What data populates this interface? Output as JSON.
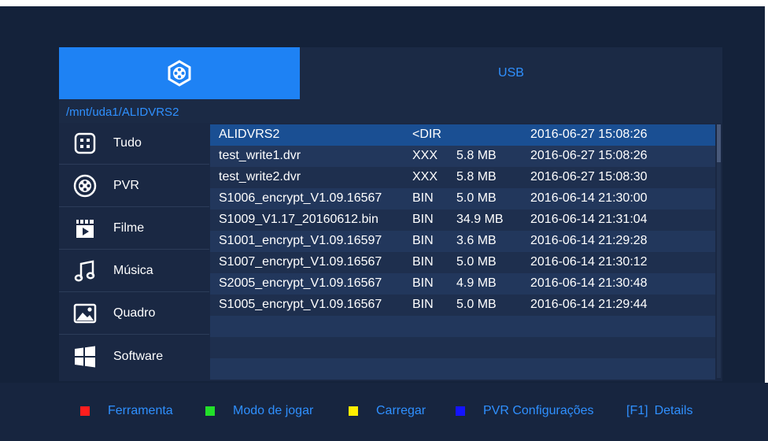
{
  "header": {
    "logo_icon": "film-reel-icon",
    "title": "USB",
    "accent_color": "#1e82f4"
  },
  "path": "/mnt/uda1/ALIDVRS2",
  "sidebar": {
    "items": [
      {
        "label": "Tudo",
        "icon": "grid-icon"
      },
      {
        "label": "PVR",
        "icon": "film-reel-icon"
      },
      {
        "label": "Filme",
        "icon": "clapperboard-icon"
      },
      {
        "label": "Música",
        "icon": "music-note-icon"
      },
      {
        "label": "Quadro",
        "icon": "picture-icon"
      },
      {
        "label": "Software",
        "icon": "windows-icon"
      }
    ]
  },
  "files": [
    {
      "name": "ALIDVRS2",
      "type": "<DIR",
      "size": "",
      "date": "2016-06-27 15:08:26",
      "selected": true
    },
    {
      "name": "test_write1.dvr",
      "type": "XXX",
      "size": "5.8 MB",
      "date": "2016-06-27 15:08:26"
    },
    {
      "name": "test_write2.dvr",
      "type": "XXX",
      "size": "5.8 MB",
      "date": "2016-06-27 15:08:30"
    },
    {
      "name": "S1006_encrypt_V1.09.16567",
      "type": "BIN",
      "size": "5.0 MB",
      "date": "2016-06-14 21:30:00"
    },
    {
      "name": "S1009_V1.17_20160612.bin",
      "type": "BIN",
      "size": "34.9 MB",
      "date": "2016-06-14 21:31:04"
    },
    {
      "name": "S1001_encrypt_V1.09.16597",
      "type": "BIN",
      "size": "3.6 MB",
      "date": "2016-06-14 21:29:28"
    },
    {
      "name": "S1007_encrypt_V1.09.16567",
      "type": "BIN",
      "size": "5.0 MB",
      "date": "2016-06-14 21:30:12"
    },
    {
      "name": "S2005_encrypt_V1.09.16567",
      "type": "BIN",
      "size": "4.9 MB",
      "date": "2016-06-14 21:30:48"
    },
    {
      "name": "S1005_encrypt_V1.09.16567",
      "type": "BIN",
      "size": "5.0 MB",
      "date": "2016-06-14 21:29:44"
    }
  ],
  "footer": {
    "legend": [
      {
        "color": "#ff1e1e",
        "label": "Ferramenta"
      },
      {
        "color": "#22e02a",
        "label": "Modo de jogar"
      },
      {
        "color": "#ffee00",
        "label": "Carregar"
      },
      {
        "color": "#1414ff",
        "label": "PVR Configurações"
      }
    ],
    "f1_key": "[F1]",
    "f1_label": "Details"
  },
  "colors": {
    "row_odd": "#1e2f4e",
    "row_even": "#22375c",
    "selected_row": "#1a4f93",
    "text_blue": "#2f90ff"
  }
}
